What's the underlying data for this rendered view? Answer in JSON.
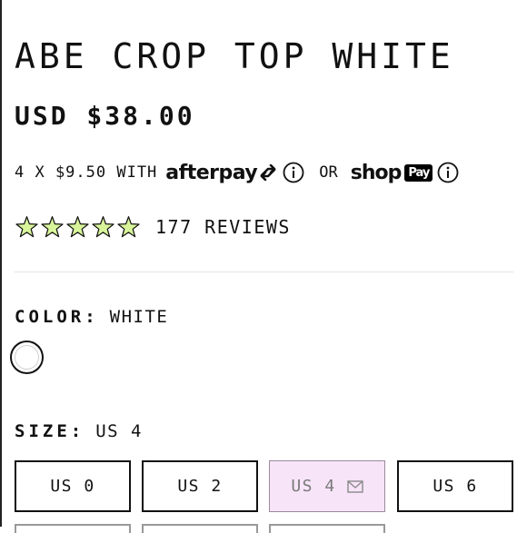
{
  "product": {
    "title": "ABE CROP TOP WHITE",
    "price": "USD $38.00"
  },
  "payment": {
    "installment_text": "4 X $9.50 WITH",
    "afterpay_logo": "afterpay",
    "or_text": "OR",
    "shop_logo": "shop",
    "pay_badge": "Pay",
    "info_icon": "info-icon"
  },
  "reviews": {
    "stars_filled": 0,
    "stars_total": 5,
    "star_fill_color": "#d8f59a",
    "count_text": "177 REVIEWS"
  },
  "color_option": {
    "label": "COLOR:",
    "selected": "WHITE",
    "swatches": [
      "#ffffff"
    ]
  },
  "size_option": {
    "label": "SIZE:",
    "selected": "US 4",
    "sizes": [
      {
        "label": "US 0",
        "sold_out": false
      },
      {
        "label": "US 2",
        "sold_out": false
      },
      {
        "label": "US 4",
        "sold_out": true
      },
      {
        "label": "US 6",
        "sold_out": false
      }
    ]
  },
  "colors": {
    "text": "#111111",
    "sold_out_bg": "#f7e4f8",
    "divider": "#e3e3e3"
  }
}
